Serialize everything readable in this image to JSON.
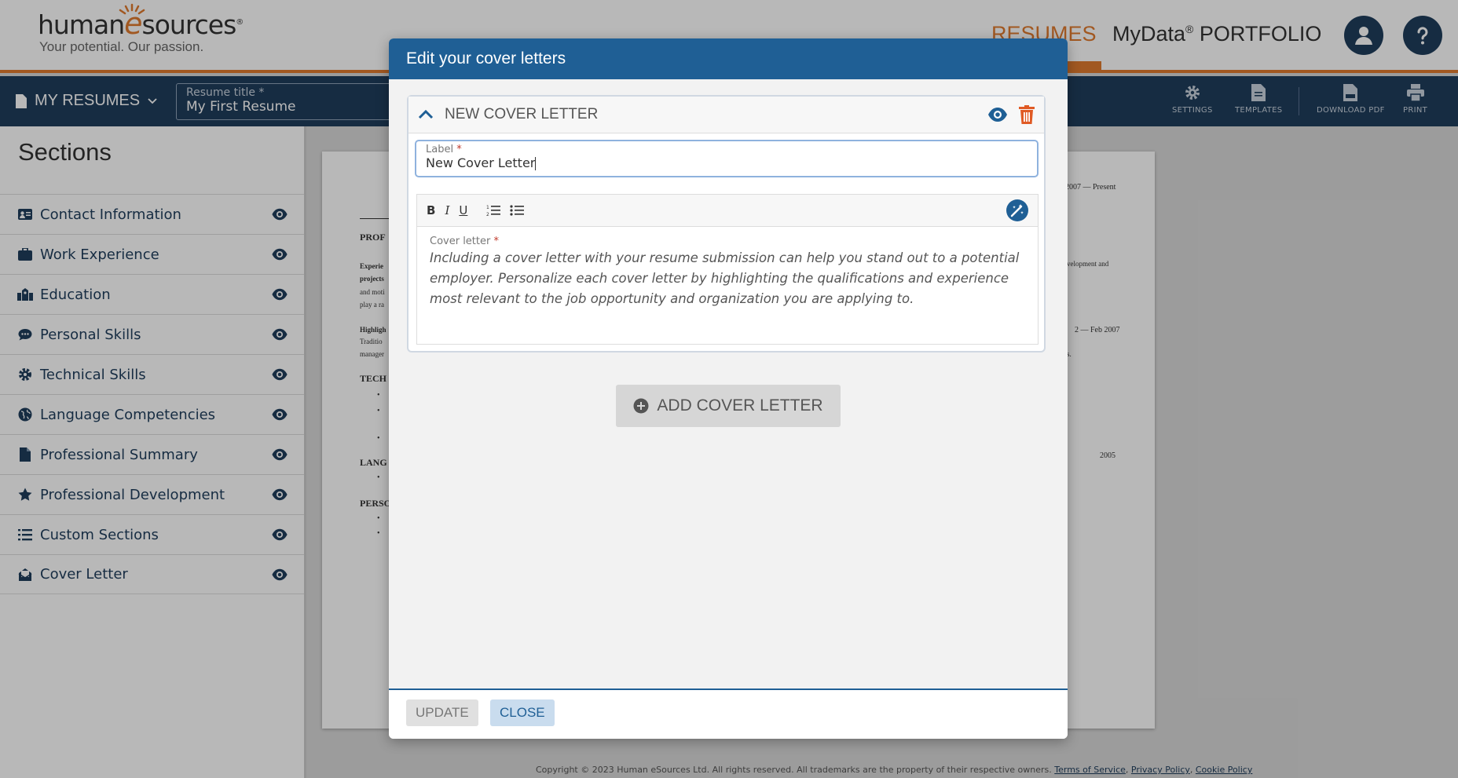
{
  "header": {
    "logo_text_1": "human",
    "logo_text_e": "e",
    "logo_text_2": "sources",
    "logo_reg": "®",
    "tagline": "Your potential. Our passion.",
    "nav_resumes": "RESUMES",
    "nav_mydata": "MyData",
    "nav_reg": "®",
    "nav_portfolio": "PORTFOLIO"
  },
  "toolbar": {
    "my_resumes": "MY RESUMES",
    "resume_title_label": "Resume title *",
    "resume_title_value": "My First Resume",
    "settings": "SETTINGS",
    "templates": "TEMPLATES",
    "download_pdf": "DOWNLOAD PDF",
    "print": "PRINT"
  },
  "sidebar": {
    "title": "Sections",
    "items": [
      {
        "label": "Contact Information",
        "icon": "id-card-icon"
      },
      {
        "label": "Work Experience",
        "icon": "briefcase-icon"
      },
      {
        "label": "Education",
        "icon": "school-icon"
      },
      {
        "label": "Personal Skills",
        "icon": "chat-icon"
      },
      {
        "label": "Technical Skills",
        "icon": "gear-icon"
      },
      {
        "label": "Language Competencies",
        "icon": "globe-icon"
      },
      {
        "label": "Professional Summary",
        "icon": "document-icon"
      },
      {
        "label": "Professional Development",
        "icon": "star-icon"
      },
      {
        "label": "Custom Sections",
        "icon": "list-icon"
      },
      {
        "label": "Cover Letter",
        "icon": "envelope-icon"
      }
    ]
  },
  "document": {
    "date1": "2007 — Present",
    "prof": "PROF",
    "experie": "Experie",
    "projects": "projects",
    "and_moti": "and moti",
    "play_a": "play a ra",
    "highligh": "Highligh",
    "traditio": "Traditio",
    "manager": "manager",
    "tech": "TECH",
    "lang": "LANG",
    "perso": "PERSO",
    "development_and": "velopment and",
    "date2": "2 — Feb 2007",
    "s_dot": "s.",
    "date3": "2005"
  },
  "footer": {
    "copyright": "Copyright © 2023 Human eSources Ltd. All rights reserved. All trademarks are the property of their respective owners.",
    "terms": "Terms of Service",
    "privacy": "Privacy Policy",
    "cookie": "Cookie Policy"
  },
  "modal": {
    "title": "Edit your cover letters",
    "panel_title": "NEW COVER LETTER",
    "label_label": "Label",
    "required_mark": "*",
    "label_value": "New Cover Letter",
    "editor_bold": "B",
    "editor_italic": "I",
    "editor_underline": "U",
    "cover_letter_label": "Cover letter",
    "cover_letter_text": "Including a cover letter with your resume submission can help you stand out to a potential employer. Personalize each cover letter by highlighting the qualifications and experience most relevant to the job opportunity and organization you are applying to.",
    "add_button": "ADD COVER LETTER",
    "update_button": "UPDATE",
    "close_button": "CLOSE"
  },
  "colors": {
    "brand_navy": "#1f3d5c",
    "modal_blue": "#1f5f95",
    "accent_orange": "#e07a2f",
    "delete_red": "#e05a24"
  }
}
